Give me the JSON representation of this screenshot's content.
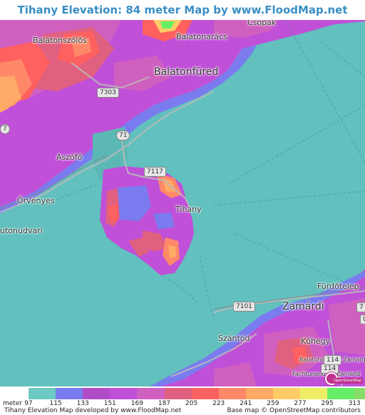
{
  "title": "Tihany Elevation: 84 meter Map by www.FloodMap.net (beta)",
  "places": {
    "csopak": "Csopak",
    "balatonszolos": "Balatonszőlős",
    "balatonaracs": "Balatonarács",
    "balatonfured": "Balatonfüred",
    "aszofo": "Aszófő",
    "orvenyes": "Örvényes",
    "tihany": "Tihany",
    "zamardi": "Zamárdi",
    "szantod": "Szántód",
    "kohegy": "Kőhegy",
    "furdotelep": "Fürdőtelep",
    "udvari": "utonudvari",
    "balatonendred": "Balatonendréd Zamárdi",
    "fachtunendrad": "Fachtunendréd Zamárdi"
  },
  "roads": {
    "r7303": "7303",
    "r71": "71",
    "r7117": "7117",
    "r7101": "7101",
    "r114": "114",
    "r7a": "7",
    "r7b": "7",
    "r114b": "114",
    "r0": "0"
  },
  "colors": {
    "water": "#62c0be",
    "level_115": "#7b7bf0",
    "level_133": "#b04cc8",
    "level_151": "#c050d8",
    "level_169": "#d060c0",
    "level_187": "#e06080",
    "level_205": "#ff6060",
    "level_223": "#ff8868",
    "level_241": "#ffaa66",
    "level_259": "#ffcc66",
    "level_277": "#eeee66",
    "level_295": "#66ee66",
    "level_313": "#88dd66"
  },
  "legend": {
    "unit": "meter",
    "ticks": [
      "97",
      "115",
      "133",
      "151",
      "169",
      "187",
      "205",
      "223",
      "241",
      "259",
      "277",
      "295",
      "313"
    ],
    "colors": [
      "#6cc9c4",
      "#7b7bf0",
      "#b04cc8",
      "#c050d8",
      "#d060c0",
      "#e06080",
      "#ff6060",
      "#ff8868",
      "#ffaa66",
      "#ffcc66",
      "#eeee66",
      "#66ee66",
      "#88dd66"
    ]
  },
  "credits": {
    "left": "Tihany Elevation Map developed by www.FloodMap.net",
    "right": "Base map © OpenStreetMap contributors"
  },
  "osm_badge": "OpenStreetMap"
}
